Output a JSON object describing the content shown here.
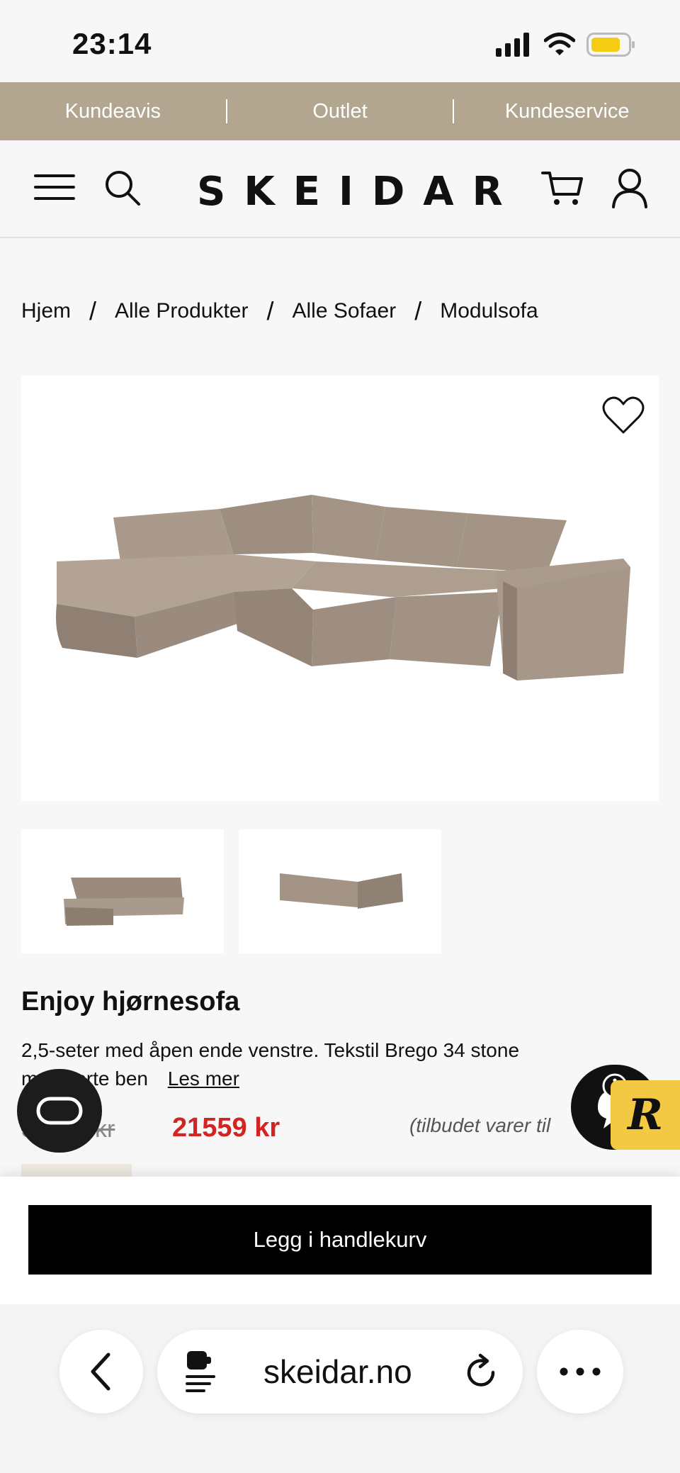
{
  "status_bar": {
    "time": "23:14"
  },
  "promo_bar": {
    "items": [
      "Kundeavis",
      "Outlet",
      "Kundeservice"
    ]
  },
  "header": {
    "logo": "SKEIDAR"
  },
  "breadcrumb": [
    "Hjem",
    "Alle Produkter",
    "Alle Sofaer",
    "Modulsofa"
  ],
  "product": {
    "title": "Enjoy hjørnesofa",
    "description": "2,5-seter med åpen ende venstre. Tekstil Brego 34 stone med sorte ben",
    "read_more": "Les mer",
    "old_price": "33169 kr",
    "new_price": "21559 kr",
    "offer_note": "(tilbudet varer til"
  },
  "actions": {
    "add_to_cart": "Legg i handlekurv"
  },
  "browser": {
    "url": "skeidar.no"
  },
  "colors": {
    "promo": "#b3a690",
    "price": "#d32323",
    "badge": "#f3c842"
  },
  "icons": [
    "wifi-icon",
    "signal-icon",
    "battery-icon",
    "menu-icon",
    "search-icon",
    "cart-icon",
    "user-icon",
    "heart-icon",
    "chat-icon",
    "back-icon",
    "reader-icon",
    "reload-icon",
    "more-icon"
  ]
}
